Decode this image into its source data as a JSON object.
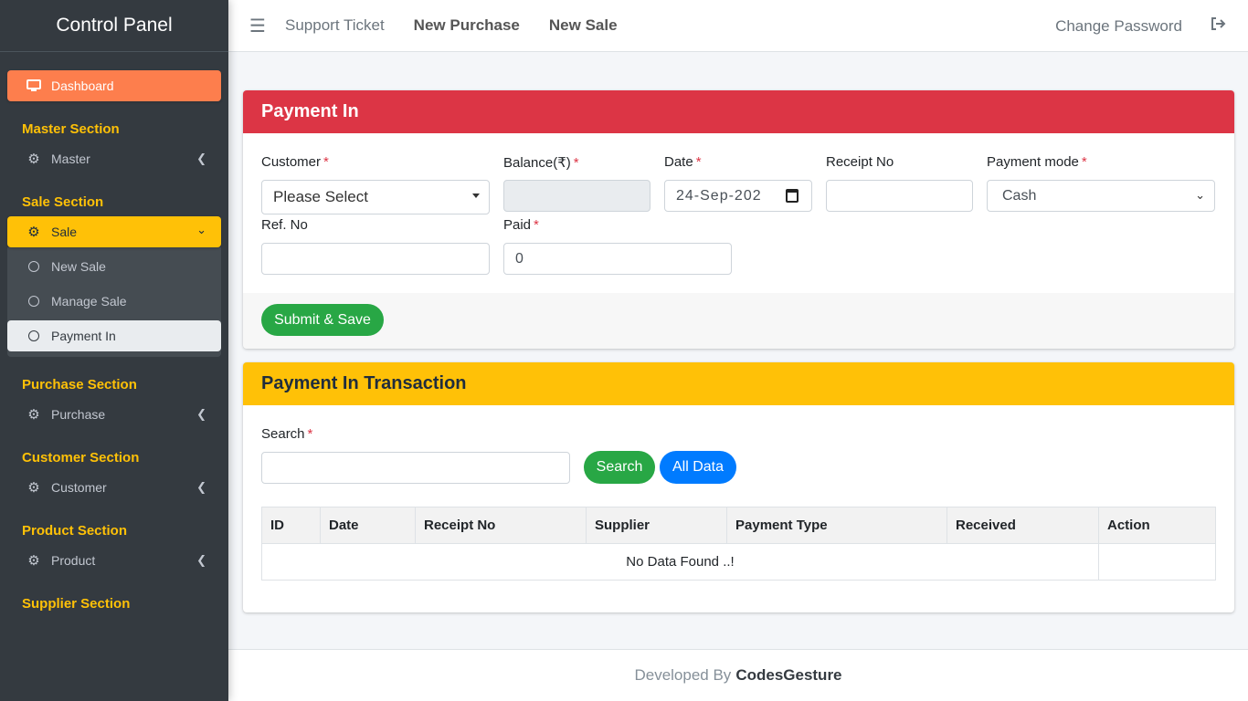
{
  "sidebar": {
    "brand": "Control Panel",
    "dashboard": "Dashboard",
    "sections": {
      "master": {
        "header": "Master Section",
        "item": "Master"
      },
      "sale": {
        "header": "Sale Section",
        "item": "Sale",
        "sub": [
          "New Sale",
          "Manage Sale",
          "Payment In"
        ]
      },
      "purchase": {
        "header": "Purchase Section",
        "item": "Purchase"
      },
      "customer": {
        "header": "Customer Section",
        "item": "Customer"
      },
      "product": {
        "header": "Product Section",
        "item": "Product"
      },
      "supplier": {
        "header": "Supplier Section"
      }
    }
  },
  "topbar": {
    "links": [
      "Support Ticket",
      "New Purchase",
      "New Sale"
    ],
    "change_password": "Change Password"
  },
  "payment_form": {
    "title": "Payment In",
    "customer_label": "Customer",
    "customer_value": "Please Select",
    "balance_label": "Balance(₹)",
    "balance_value": "",
    "date_label": "Date",
    "date_value": "24-Sep-202",
    "receipt_label": "Receipt No",
    "receipt_value": "",
    "mode_label": "Payment mode",
    "mode_value": "Cash",
    "ref_label": "Ref. No",
    "ref_value": "",
    "paid_label": "Paid",
    "paid_value": "0",
    "required_mark": "*",
    "submit_label": "Submit & Save"
  },
  "transactions": {
    "title": "Payment In Transaction",
    "search_label": "Search",
    "search_value": "",
    "search_button": "Search",
    "all_data_button": "All Data",
    "columns": [
      "ID",
      "Date",
      "Receipt No",
      "Supplier",
      "Payment Type",
      "Received",
      "Action"
    ],
    "empty_message": "No Data Found ..!"
  },
  "footer": {
    "prefix": "Developed By",
    "brand": "CodesGesture"
  },
  "colors": {
    "sidebar_bg": "#343a40",
    "accent_orange": "#fd7e4d",
    "accent_yellow": "#ffc107",
    "danger": "#dc3545",
    "success": "#28a745",
    "primary": "#007bff"
  }
}
